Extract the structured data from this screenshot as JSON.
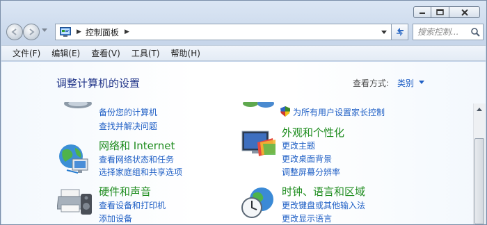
{
  "window": {
    "breadcrumb": "控制面板",
    "search_placeholder": "搜索控制..."
  },
  "menu": [
    "文件(F)",
    "编辑(E)",
    "查看(V)",
    "工具(T)",
    "帮助(H)"
  ],
  "content": {
    "heading": "调整计算机的设置",
    "view_by_label": "查看方式:",
    "view_by_value": "类别"
  },
  "categories": {
    "system_security": {
      "links": [
        "备份您的计算机",
        "查找并解决问题"
      ]
    },
    "user_accounts": {
      "links": [
        "为所有用户设置家长控制"
      ]
    },
    "network": {
      "title": "网络和 Internet",
      "links": [
        "查看网络状态和任务",
        "选择家庭组和共享选项"
      ]
    },
    "appearance": {
      "title": "外观和个性化",
      "links": [
        "更改主题",
        "更改桌面背景",
        "调整屏幕分辨率"
      ]
    },
    "hardware": {
      "title": "硬件和声音",
      "links": [
        "查看设备和打印机",
        "添加设备"
      ]
    },
    "clock": {
      "title": "时钟、语言和区域",
      "links": [
        "更改键盘或其他输入法",
        "更改显示语言"
      ]
    }
  },
  "colors": {
    "category_title": "#1e8c1e",
    "link": "#1f5fc5",
    "heading": "#1e3287"
  }
}
